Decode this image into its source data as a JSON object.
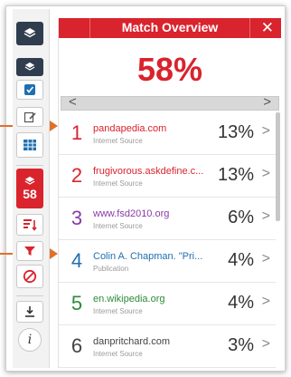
{
  "header": {
    "title": "Match Overview",
    "close_glyph": "✕"
  },
  "score": "58%",
  "nav": {
    "prev": "<",
    "next": ">"
  },
  "toolbar": {
    "match_count": "58",
    "icons": [
      "layers-icon",
      "layers-icon",
      "checkbox-icon",
      "edit-icon",
      "grid-icon",
      "layers-icon",
      "filter-sort-icon",
      "filter-icon",
      "block-icon",
      "download-icon",
      "info-icon"
    ]
  },
  "matches": [
    {
      "rank": "1",
      "source": "pandapedia.com",
      "type": "Internet Source",
      "percent": "13%",
      "color": "#d9232d"
    },
    {
      "rank": "2",
      "source": "frugivorous.askdefine.c...",
      "type": "Internet Source",
      "percent": "13%",
      "color": "#d9232d"
    },
    {
      "rank": "3",
      "source": "www.fsd2010.org",
      "type": "Internet Source",
      "percent": "6%",
      "color": "#8a3aa8"
    },
    {
      "rank": "4",
      "source": "Colin A. Chapman. \"Pri...",
      "type": "Publication",
      "percent": "4%",
      "color": "#1f6fb0"
    },
    {
      "rank": "5",
      "source": "en.wikipedia.org",
      "type": "Internet Source",
      "percent": "4%",
      "color": "#2e8b3a"
    },
    {
      "rank": "6",
      "source": "danpritchard.com",
      "type": "Internet Source",
      "percent": "3%",
      "color": "#444444"
    }
  ],
  "chevron": ">"
}
